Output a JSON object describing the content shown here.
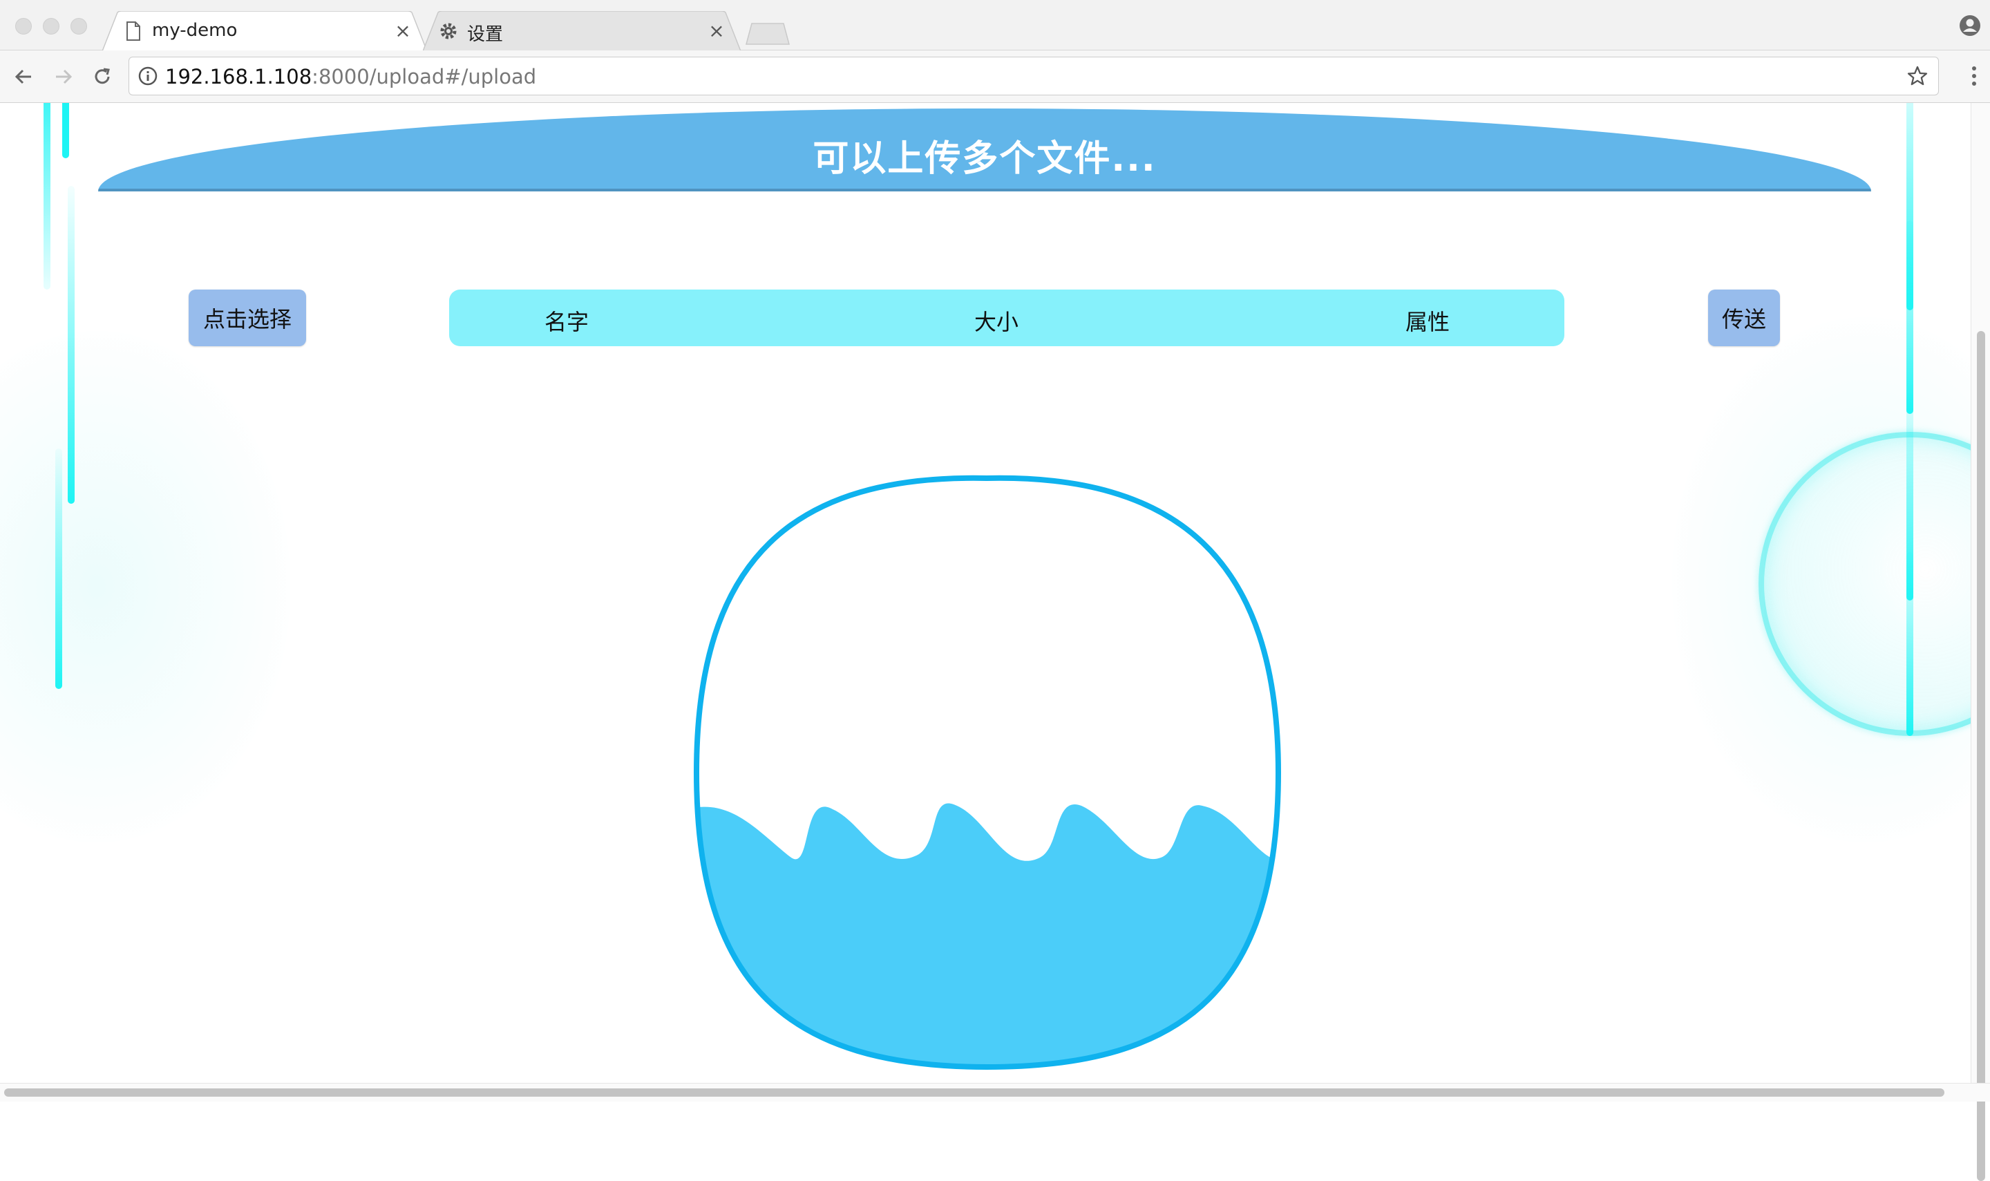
{
  "browser": {
    "tabs": [
      {
        "title": "my-demo",
        "icon": "document-icon",
        "active": true
      },
      {
        "title": "设置",
        "icon": "gear-icon",
        "active": false
      }
    ],
    "address": {
      "host": "192.168.1.108",
      "rest": ":8000/upload#/upload"
    },
    "close_glyph": "×"
  },
  "page": {
    "banner_title": "可以上传多个文件...",
    "select_button": "点击选择",
    "send_button": "传送",
    "columns": {
      "name": "名字",
      "size": "大小",
      "attr": "属性"
    }
  },
  "colors": {
    "banner": "#62b6ea",
    "button": "#97bcec",
    "header_bar": "#86f1fb",
    "water": "#4bcdf9",
    "vessel_outline": "#0fb2ee",
    "decor_cyan": "#1ef4f4"
  }
}
